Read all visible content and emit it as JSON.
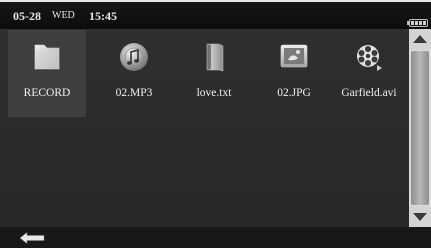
{
  "status": {
    "date": "05-28",
    "day": "WED",
    "time": "15:45"
  },
  "files": [
    {
      "label": "RECORD",
      "icon": "folder-icon",
      "selected": true
    },
    {
      "label": "02.MP3",
      "icon": "music-file-icon",
      "selected": false
    },
    {
      "label": "love.txt",
      "icon": "text-file-icon",
      "selected": false
    },
    {
      "label": "02.JPG",
      "icon": "image-file-icon",
      "selected": false
    },
    {
      "label": "Garfield.avi",
      "icon": "video-file-icon",
      "selected": false
    }
  ],
  "colors": {
    "screen_bg": "#2b2b2b",
    "statusbar_bg": "#111111",
    "text": "#f0f0f0",
    "selection": "#3e3e3e"
  }
}
